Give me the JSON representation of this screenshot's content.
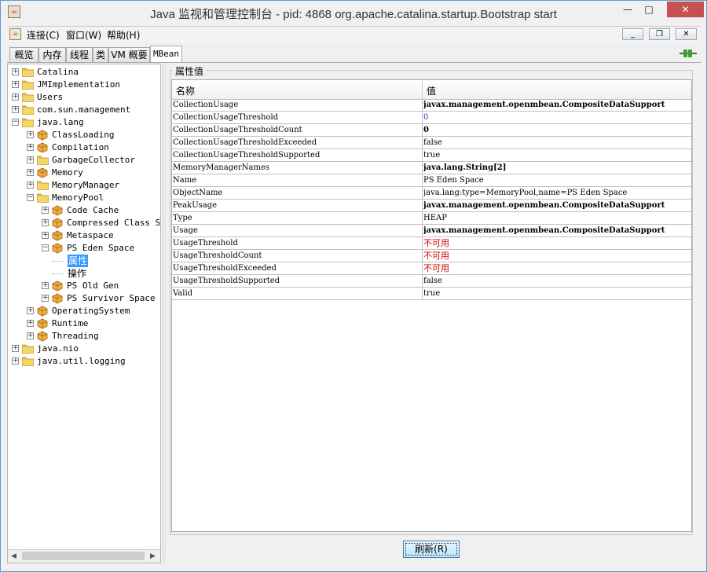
{
  "window": {
    "title": "Java 监视和管理控制台 - pid: 4868 org.apache.catalina.startup.Bootstrap start",
    "min_glyph": "—",
    "max_glyph": "□",
    "close_glyph": "✕"
  },
  "menubar": {
    "items": [
      "连接(C)",
      "窗口(W)",
      "帮助(H)"
    ],
    "mdi_min": "_",
    "mdi_restore": "❐",
    "mdi_close": "✕"
  },
  "tabs": [
    {
      "label": "概览"
    },
    {
      "label": "内存"
    },
    {
      "label": "线程"
    },
    {
      "label": "类"
    },
    {
      "label": "VM 概要"
    },
    {
      "label": "MBean",
      "active": true
    }
  ],
  "tree": {
    "nodes": [
      {
        "label": "Catalina",
        "type": "folder",
        "expander": "+",
        "depth": 0
      },
      {
        "label": "JMImplementation",
        "type": "folder",
        "expander": "+",
        "depth": 0
      },
      {
        "label": "Users",
        "type": "folder",
        "expander": "+",
        "depth": 0
      },
      {
        "label": "com.sun.management",
        "type": "folder",
        "expander": "+",
        "depth": 0
      },
      {
        "label": "java.lang",
        "type": "folder",
        "expander": "−",
        "depth": 0
      },
      {
        "label": "ClassLoading",
        "type": "bean",
        "expander": "+",
        "depth": 1
      },
      {
        "label": "Compilation",
        "type": "bean",
        "expander": "+",
        "depth": 1
      },
      {
        "label": "GarbageCollector",
        "type": "folder",
        "expander": "+",
        "depth": 1
      },
      {
        "label": "Memory",
        "type": "bean",
        "expander": "+",
        "depth": 1
      },
      {
        "label": "MemoryManager",
        "type": "folder",
        "expander": "+",
        "depth": 1
      },
      {
        "label": "MemoryPool",
        "type": "folder",
        "expander": "−",
        "depth": 1
      },
      {
        "label": "Code Cache",
        "type": "bean",
        "expander": "+",
        "depth": 2
      },
      {
        "label": "Compressed Class Space",
        "type": "bean",
        "expander": "+",
        "depth": 2
      },
      {
        "label": "Metaspace",
        "type": "bean",
        "expander": "+",
        "depth": 2
      },
      {
        "label": "PS Eden Space",
        "type": "bean",
        "expander": "−",
        "depth": 2
      },
      {
        "label": "属性",
        "type": "leaf",
        "expander": "+",
        "depth": 3,
        "selected": true
      },
      {
        "label": "操作",
        "type": "leaf",
        "expander": "+",
        "depth": 3
      },
      {
        "label": "PS Old Gen",
        "type": "bean",
        "expander": "+",
        "depth": 2
      },
      {
        "label": "PS Survivor Space",
        "type": "bean",
        "expander": "+",
        "depth": 2
      },
      {
        "label": "OperatingSystem",
        "type": "bean",
        "expander": "+",
        "depth": 1
      },
      {
        "label": "Runtime",
        "type": "bean",
        "expander": "+",
        "depth": 1
      },
      {
        "label": "Threading",
        "type": "bean",
        "expander": "+",
        "depth": 1
      },
      {
        "label": "java.nio",
        "type": "folder",
        "expander": "+",
        "depth": 0
      },
      {
        "label": "java.util.logging",
        "type": "folder",
        "expander": "+",
        "depth": 0
      }
    ],
    "scroll_left_glyph": "◀",
    "scroll_right_glyph": "▶"
  },
  "attributes": {
    "group_title": "属性值",
    "columns": [
      "名称",
      "值"
    ],
    "rows": [
      {
        "name": "CollectionUsage",
        "value": "javax.management.openmbean.CompositeDataSupport",
        "style": "bold"
      },
      {
        "name": "CollectionUsageThreshold",
        "value": "0",
        "style": "blue"
      },
      {
        "name": "CollectionUsageThresholdCount",
        "value": "0",
        "style": "bold"
      },
      {
        "name": "CollectionUsageThresholdExceeded",
        "value": "false",
        "style": ""
      },
      {
        "name": "CollectionUsageThresholdSupported",
        "value": "true",
        "style": ""
      },
      {
        "name": "MemoryManagerNames",
        "value": "java.lang.String[2]",
        "style": "bold"
      },
      {
        "name": "Name",
        "value": "PS Eden Space",
        "style": ""
      },
      {
        "name": "ObjectName",
        "value": "java.lang:type=MemoryPool,name=PS Eden Space",
        "style": ""
      },
      {
        "name": "PeakUsage",
        "value": "javax.management.openmbean.CompositeDataSupport",
        "style": "bold"
      },
      {
        "name": "Type",
        "value": "HEAP",
        "style": ""
      },
      {
        "name": "Usage",
        "value": "javax.management.openmbean.CompositeDataSupport",
        "style": "bold"
      },
      {
        "name": "UsageThreshold",
        "value": "不可用",
        "style": "red"
      },
      {
        "name": "UsageThresholdCount",
        "value": "不可用",
        "style": "red"
      },
      {
        "name": "UsageThresholdExceeded",
        "value": "不可用",
        "style": "red"
      },
      {
        "name": "UsageThresholdSupported",
        "value": "false",
        "style": ""
      },
      {
        "name": "Valid",
        "value": "true",
        "style": ""
      }
    ]
  },
  "refresh_button": "刷新(R)",
  "colors": {
    "selection": "#3399ff",
    "unavailable": "#d00000",
    "numeric": "#2040c0",
    "close_button": "#c75050"
  }
}
